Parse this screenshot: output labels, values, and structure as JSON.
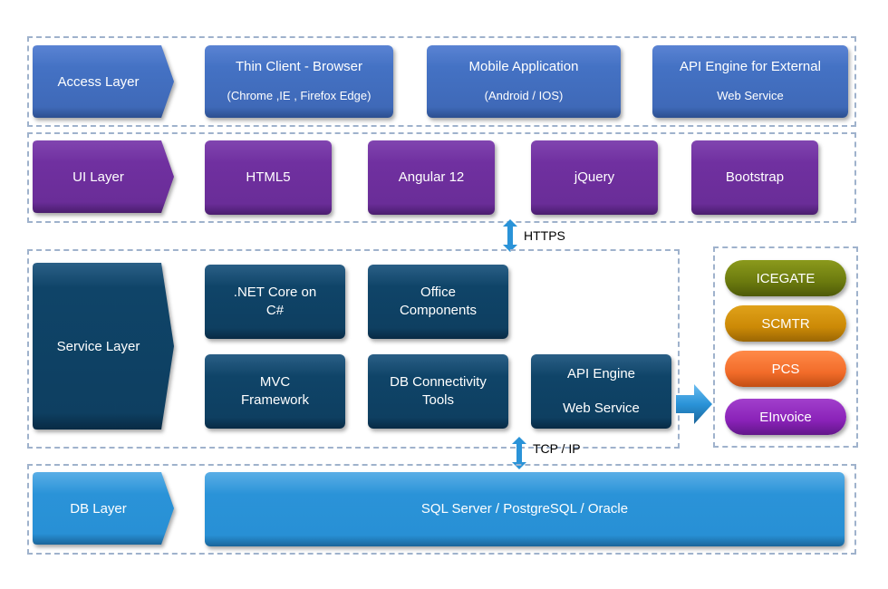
{
  "colors": {
    "access": "#4472c4",
    "ui": "#7030a0",
    "service": "#0f4468",
    "db": "#2a93d8",
    "arrow": "#2a93d8",
    "dash": "#9fb2cc"
  },
  "layers": {
    "access": {
      "label": "Access Layer",
      "items": [
        {
          "title": "Thin Client - Browser",
          "subtitle": "(Chrome ,IE , Firefox Edge)"
        },
        {
          "title": "Mobile Application",
          "subtitle": "(Android / IOS)"
        },
        {
          "title": "API Engine for External",
          "subtitle": "Web Service"
        }
      ]
    },
    "ui": {
      "label": "UI Layer",
      "items": [
        "HTML5",
        "Angular 12",
        "jQuery",
        "Bootstrap"
      ]
    },
    "service": {
      "label": "Service Layer",
      "items": [
        {
          "line1": ".NET Core on",
          "line2": "C#"
        },
        {
          "line1": "Office",
          "line2": "Components"
        },
        {
          "line1": "MVC",
          "line2": "Framework"
        },
        {
          "line1": "DB Connectivity",
          "line2": "Tools"
        },
        {
          "line1": "API Engine",
          "line2": "Web Service"
        }
      ]
    },
    "db": {
      "label": "DB Layer",
      "items": [
        "SQL Server / PostgreSQL / Oracle"
      ]
    }
  },
  "external_systems": [
    "ICEGATE",
    "SCMTR",
    "PCS",
    "EInvoice"
  ],
  "connectors": {
    "ui_to_service": "HTTPS",
    "service_to_db": "TCP / IP"
  }
}
